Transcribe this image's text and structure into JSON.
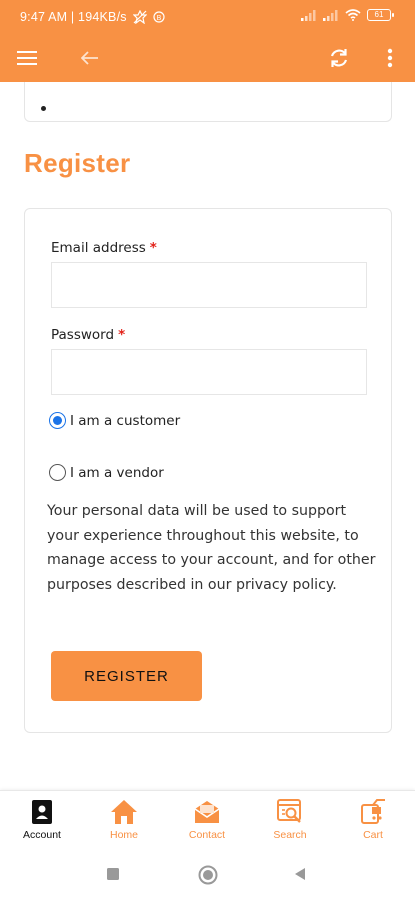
{
  "status_bar": {
    "time_speed": "9:47 AM | 194KB/s",
    "battery_level": "61"
  },
  "app_bar": {
    "menu_icon": "hamburger-icon",
    "back_icon": "arrow-left-icon",
    "refresh_icon": "refresh-icon",
    "more_icon": "more-vert-icon"
  },
  "page": {
    "title": "Register"
  },
  "form": {
    "email_label": "Email address",
    "email_value": "",
    "password_label": "Password",
    "password_value": "",
    "required_mark": "*",
    "role_options": [
      {
        "label": "I am a customer",
        "selected": true
      },
      {
        "label": "I am a vendor",
        "selected": false
      }
    ],
    "privacy_text": "Your personal data will be used to support your experience throughout this website, to manage access to your account, and for other purposes described in our privacy policy.",
    "submit_label": "REGISTER"
  },
  "bottom_nav": {
    "items": [
      {
        "label": "Account",
        "icon": "account-icon",
        "active": true
      },
      {
        "label": "Home",
        "icon": "home-icon",
        "active": false
      },
      {
        "label": "Contact",
        "icon": "mail-icon",
        "active": false
      },
      {
        "label": "Search",
        "icon": "search-icon",
        "active": false
      },
      {
        "label": "Cart",
        "icon": "cart-icon",
        "active": false
      }
    ]
  },
  "colors": {
    "brand": "#f89144",
    "radio_selected": "#1a73e8",
    "required": "#e2231a"
  }
}
